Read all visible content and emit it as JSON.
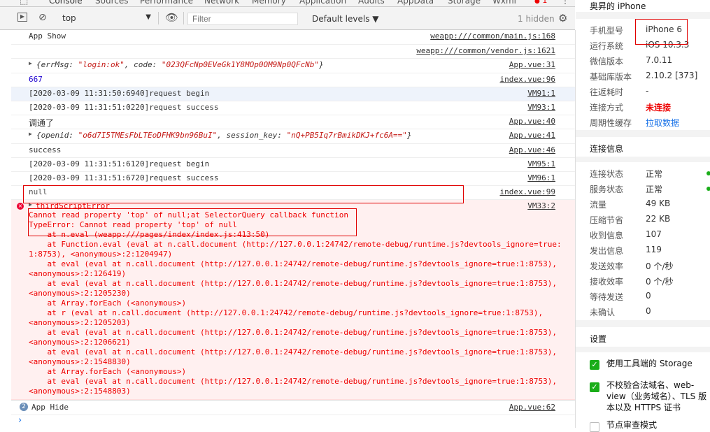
{
  "tabs": [
    "Console",
    "Sources",
    "Performance",
    "Network",
    "Memory",
    "Application",
    "Audits",
    "AppData",
    "Storage",
    "Wxml"
  ],
  "error_count": "1",
  "toolbar": {
    "context": "top",
    "filter_placeholder": "Filter",
    "levels": "Default levels ▼",
    "hidden": "1 hidden"
  },
  "console": {
    "rows": [
      {
        "msg": "App Show",
        "src": "weapp:///common/main.js:168"
      },
      {
        "msg": "",
        "src": "weapp:///common/vendor.js:1621"
      },
      {
        "msg_parts": [
          "{errMsg: ",
          "\"login:ok\"",
          ", code: ",
          "\"023QFcNp0EVeGk1Y8MOp0OM9Np0QFcNb\"",
          "}"
        ],
        "src": "App.vue:31"
      },
      {
        "msg": "667",
        "src": "index.vue:96"
      },
      {
        "msg": "[2020-03-09 11:31:50:6940]request begin",
        "src": "VM91:1"
      },
      {
        "msg": "[2020-03-09 11:31:51:0220]request success",
        "src": "VM93:1"
      },
      {
        "msg": "调通了",
        "src": "App.vue:40"
      },
      {
        "msg_parts": [
          "{openid: ",
          "\"o6d7I5TMEsFbLTEoDFHK9bn96BuI\"",
          ", session_key: ",
          "\"nQ+PB5Iq7rBmikDKJ+fc6A==\"",
          "}"
        ],
        "src": "App.vue:41"
      },
      {
        "msg": "success",
        "src": "App.vue:46"
      },
      {
        "msg": "[2020-03-09 11:31:51:6120]request begin",
        "src": "VM95:1"
      },
      {
        "msg": "[2020-03-09 11:31:51:6720]request success",
        "src": "VM96:1"
      },
      {
        "msg": "null",
        "src": "index.vue:99"
      }
    ],
    "error": {
      "title": "thirdScriptError",
      "src": "VM33:2",
      "lines": [
        "Cannot read property 'top' of null;at SelectorQuery callback function",
        "TypeError: Cannot read property 'top' of null",
        "    at n.eval (weapp:///pages/index/index.js:413:50)",
        "    at Function.eval (eval at n.call.document (http://127.0.0.1:24742/remote-debug/runtime.js?devtools_ignore=true:",
        "1:8753), <anonymous>:2:1204947)",
        "    at eval (eval at n.call.document (http://127.0.0.1:24742/remote-debug/runtime.js?devtools_ignore=true:1:8753),",
        "<anonymous>:2:126419)",
        "    at eval (eval at n.call.document (http://127.0.0.1:24742/remote-debug/runtime.js?devtools_ignore=true:1:8753),",
        "<anonymous>:2:1205230)",
        "    at Array.forEach (<anonymous>)",
        "    at r (eval at n.call.document (http://127.0.0.1:24742/remote-debug/runtime.js?devtools_ignore=true:1:8753),",
        "<anonymous>:2:1205203)",
        "    at eval (eval at n.call.document (http://127.0.0.1:24742/remote-debug/runtime.js?devtools_ignore=true:1:8753),",
        "<anonymous>:2:1206621)",
        "    at eval (eval at n.call.document (http://127.0.0.1:24742/remote-debug/runtime.js?devtools_ignore=true:1:8753),",
        "<anonymous>:2:1548830)",
        "    at Array.forEach (<anonymous>)",
        "    at eval (eval at n.call.document (http://127.0.0.1:24742/remote-debug/runtime.js?devtools_ignore=true:1:8753),",
        "<anonymous>:2:1548803)"
      ]
    },
    "last": {
      "count": "2",
      "msg": "App Hide",
      "src": "App.vue:62"
    },
    "prompt": "›"
  },
  "panel": {
    "title": "奥昇的 iPhone",
    "device": [
      {
        "label": "手机型号",
        "value": "iPhone 6"
      },
      {
        "label": "运行系统",
        "value": "iOS 10.3.3"
      },
      {
        "label": "微信版本",
        "value": "7.0.11"
      },
      {
        "label": "基础库版本",
        "value": "2.10.2 [373]"
      },
      {
        "label": "往返耗时",
        "value": "-"
      },
      {
        "label": "连接方式",
        "value": "未连接"
      },
      {
        "label": "周期性缓存",
        "value": "拉取数据"
      }
    ],
    "conn_title": "连接信息",
    "conn": [
      {
        "label": "连接状态",
        "value": "正常"
      },
      {
        "label": "服务状态",
        "value": "正常"
      },
      {
        "label": "流量",
        "value": "49 KB"
      },
      {
        "label": "压缩节省",
        "value": "22 KB"
      },
      {
        "label": "收到信息",
        "value": "107"
      },
      {
        "label": "发出信息",
        "value": "119"
      },
      {
        "label": "发送效率",
        "value": "0 个/秒"
      },
      {
        "label": "接收效率",
        "value": "0 个/秒"
      },
      {
        "label": "等待发送",
        "value": "0"
      },
      {
        "label": "未确认",
        "value": "0"
      }
    ],
    "settings_title": "设置",
    "settings": [
      {
        "text": "使用工具端的 Storage",
        "checked": true
      },
      {
        "text": "不校验合法域名、web-view（业务域名）、TLS 版本以及 HTTPS 证书",
        "checked": true
      },
      {
        "text": "节点审查模式",
        "checked": false
      }
    ]
  }
}
